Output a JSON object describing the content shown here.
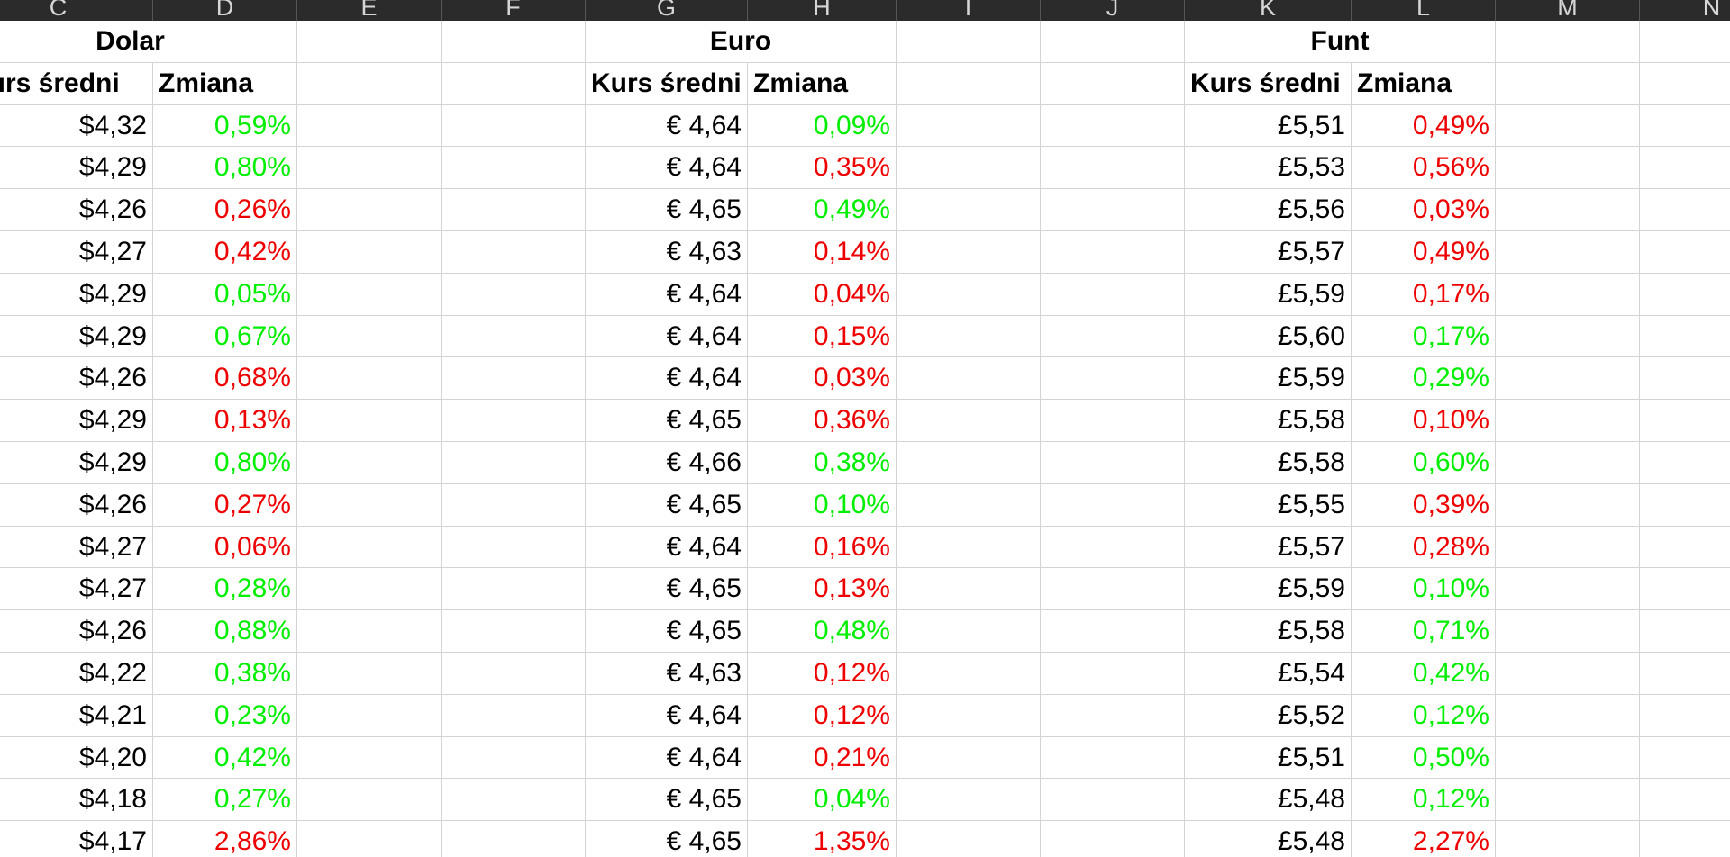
{
  "column_headers": [
    "C",
    "D",
    "E",
    "F",
    "G",
    "H",
    "I",
    "J",
    "K",
    "L",
    "M",
    "N"
  ],
  "colors": {
    "positive": "#00ee00",
    "negative": "#ee0000",
    "header_bg": "#2b2b2b",
    "gridline": "#d4d4d4"
  },
  "sections": [
    {
      "title": "Dolar",
      "rate_header": "Kurs średni",
      "change_header": "Zmiana",
      "rows": [
        {
          "rate": "$4,32",
          "change": "0,59%",
          "trend": "positive"
        },
        {
          "rate": "$4,29",
          "change": "0,80%",
          "trend": "positive"
        },
        {
          "rate": "$4,26",
          "change": "0,26%",
          "trend": "negative"
        },
        {
          "rate": "$4,27",
          "change": "0,42%",
          "trend": "negative"
        },
        {
          "rate": "$4,29",
          "change": "0,05%",
          "trend": "positive"
        },
        {
          "rate": "$4,29",
          "change": "0,67%",
          "trend": "positive"
        },
        {
          "rate": "$4,26",
          "change": "0,68%",
          "trend": "negative"
        },
        {
          "rate": "$4,29",
          "change": "0,13%",
          "trend": "negative"
        },
        {
          "rate": "$4,29",
          "change": "0,80%",
          "trend": "positive"
        },
        {
          "rate": "$4,26",
          "change": "0,27%",
          "trend": "negative"
        },
        {
          "rate": "$4,27",
          "change": "0,06%",
          "trend": "negative"
        },
        {
          "rate": "$4,27",
          "change": "0,28%",
          "trend": "positive"
        },
        {
          "rate": "$4,26",
          "change": "0,88%",
          "trend": "positive"
        },
        {
          "rate": "$4,22",
          "change": "0,38%",
          "trend": "positive"
        },
        {
          "rate": "$4,21",
          "change": "0,23%",
          "trend": "positive"
        },
        {
          "rate": "$4,20",
          "change": "0,42%",
          "trend": "positive"
        },
        {
          "rate": "$4,18",
          "change": "0,27%",
          "trend": "positive"
        },
        {
          "rate": "$4,17",
          "change": "2,86%",
          "trend": "negative"
        }
      ]
    },
    {
      "title": "Euro",
      "rate_header": "Kurs średni",
      "change_header": "Zmiana",
      "rows": [
        {
          "rate": "€ 4,64",
          "change": "0,09%",
          "trend": "positive"
        },
        {
          "rate": "€ 4,64",
          "change": "0,35%",
          "trend": "negative"
        },
        {
          "rate": "€ 4,65",
          "change": "0,49%",
          "trend": "positive"
        },
        {
          "rate": "€ 4,63",
          "change": "0,14%",
          "trend": "negative"
        },
        {
          "rate": "€ 4,64",
          "change": "0,04%",
          "trend": "negative"
        },
        {
          "rate": "€ 4,64",
          "change": "0,15%",
          "trend": "negative"
        },
        {
          "rate": "€ 4,64",
          "change": "0,03%",
          "trend": "negative"
        },
        {
          "rate": "€ 4,65",
          "change": "0,36%",
          "trend": "negative"
        },
        {
          "rate": "€ 4,66",
          "change": "0,38%",
          "trend": "positive"
        },
        {
          "rate": "€ 4,65",
          "change": "0,10%",
          "trend": "positive"
        },
        {
          "rate": "€ 4,64",
          "change": "0,16%",
          "trend": "negative"
        },
        {
          "rate": "€ 4,65",
          "change": "0,13%",
          "trend": "negative"
        },
        {
          "rate": "€ 4,65",
          "change": "0,48%",
          "trend": "positive"
        },
        {
          "rate": "€ 4,63",
          "change": "0,12%",
          "trend": "negative"
        },
        {
          "rate": "€ 4,64",
          "change": "0,12%",
          "trend": "negative"
        },
        {
          "rate": "€ 4,64",
          "change": "0,21%",
          "trend": "negative"
        },
        {
          "rate": "€ 4,65",
          "change": "0,04%",
          "trend": "positive"
        },
        {
          "rate": "€ 4,65",
          "change": "1,35%",
          "trend": "negative"
        }
      ]
    },
    {
      "title": "Funt",
      "rate_header": "Kurs średni",
      "change_header": "Zmiana",
      "rows": [
        {
          "rate": "£5,51",
          "change": "0,49%",
          "trend": "negative"
        },
        {
          "rate": "£5,53",
          "change": "0,56%",
          "trend": "negative"
        },
        {
          "rate": "£5,56",
          "change": "0,03%",
          "trend": "negative"
        },
        {
          "rate": "£5,57",
          "change": "0,49%",
          "trend": "negative"
        },
        {
          "rate": "£5,59",
          "change": "0,17%",
          "trend": "negative"
        },
        {
          "rate": "£5,60",
          "change": "0,17%",
          "trend": "positive"
        },
        {
          "rate": "£5,59",
          "change": "0,29%",
          "trend": "positive"
        },
        {
          "rate": "£5,58",
          "change": "0,10%",
          "trend": "negative"
        },
        {
          "rate": "£5,58",
          "change": "0,60%",
          "trend": "positive"
        },
        {
          "rate": "£5,55",
          "change": "0,39%",
          "trend": "negative"
        },
        {
          "rate": "£5,57",
          "change": "0,28%",
          "trend": "negative"
        },
        {
          "rate": "£5,59",
          "change": "0,10%",
          "trend": "positive"
        },
        {
          "rate": "£5,58",
          "change": "0,71%",
          "trend": "positive"
        },
        {
          "rate": "£5,54",
          "change": "0,42%",
          "trend": "positive"
        },
        {
          "rate": "£5,52",
          "change": "0,12%",
          "trend": "positive"
        },
        {
          "rate": "£5,51",
          "change": "0,50%",
          "trend": "positive"
        },
        {
          "rate": "£5,48",
          "change": "0,12%",
          "trend": "positive"
        },
        {
          "rate": "£5,48",
          "change": "2,27%",
          "trend": "negative"
        }
      ]
    }
  ]
}
